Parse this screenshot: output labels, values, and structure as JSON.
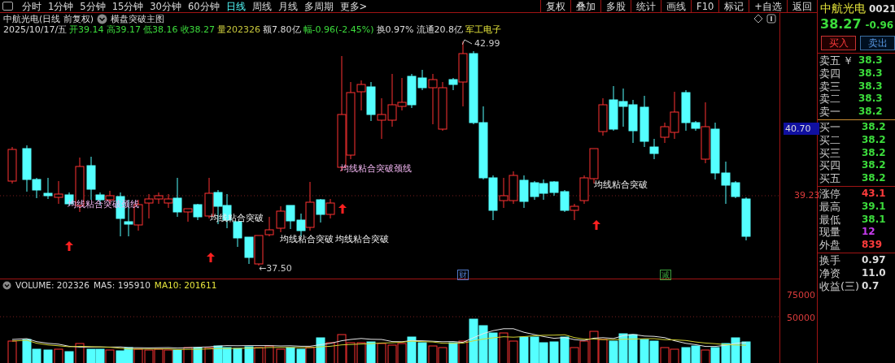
{
  "toolbar": {
    "periods": [
      {
        "label": "分时",
        "selected": false
      },
      {
        "label": "1分钟",
        "selected": false
      },
      {
        "label": "5分钟",
        "selected": false
      },
      {
        "label": "15分钟",
        "selected": false
      },
      {
        "label": "30分钟",
        "selected": false
      },
      {
        "label": "60分钟",
        "selected": false
      },
      {
        "label": "日线",
        "selected": true
      },
      {
        "label": "周线",
        "selected": false
      },
      {
        "label": "月线",
        "selected": false
      },
      {
        "label": "多周期",
        "selected": false
      },
      {
        "label": "更多>",
        "selected": false
      }
    ],
    "buttons": [
      "复权",
      "叠加",
      "多股",
      "统计",
      "画线",
      "F10",
      "标记",
      "+自选",
      "返回"
    ]
  },
  "title": {
    "stock": "中航光电(日线 前复权)",
    "indicator": "横盘突破主图"
  },
  "quote_line": [
    {
      "text": "2025/10/17/五",
      "kind": "plain"
    },
    {
      "text": "开39.14",
      "kind": "down"
    },
    {
      "text": "高39.17",
      "kind": "down"
    },
    {
      "text": "低38.16",
      "kind": "down"
    },
    {
      "text": "收38.27",
      "kind": "down"
    },
    {
      "text": "量202326",
      "kind": "volume"
    },
    {
      "text": "额7.80亿",
      "kind": "plain"
    },
    {
      "text": "幅-0.96(-2.45%)",
      "kind": "down"
    },
    {
      "text": "换0.97%",
      "kind": "plain"
    },
    {
      "text": "流通20.8亿",
      "kind": "plain"
    },
    {
      "text": "军工电子",
      "kind": "sector"
    }
  ],
  "chart": {
    "annotations": [
      {
        "text": "均线粘合突破颈线",
        "kind": "neckline"
      },
      {
        "text": "均线粘合突破",
        "kind": "breakout"
      },
      {
        "text": "均线粘合突破",
        "kind": "breakout"
      },
      {
        "text": "均线粘合突破",
        "kind": "breakout"
      },
      {
        "text": "均线粘合突破颈线",
        "kind": "neckline"
      },
      {
        "text": "均线粘合突破",
        "kind": "breakout"
      }
    ],
    "high_mark": "42.99",
    "low_mark": "←37.50",
    "events": [
      {
        "text": "财",
        "color": "#5078c8"
      },
      {
        "text": "减",
        "color": "#3ca03c"
      }
    ]
  },
  "axis": {
    "cursor": "40.70",
    "level": "39.23",
    "volume_ticks": [
      "75000",
      "50000"
    ]
  },
  "volume": {
    "legend": [
      {
        "text": "VOLUME: 202326",
        "color": "#dcdcdc"
      },
      {
        "text": "MA5: 195910",
        "color": "#dcdcdc"
      },
      {
        "text": "MA10: 201611",
        "color": "#e6e63c"
      }
    ]
  },
  "quote": {
    "name": "中航光电",
    "code": "0021",
    "price": "38.27",
    "change": "-0.96",
    "buy": "买入",
    "sell": "卖出",
    "symbol": "￥",
    "book": [
      {
        "label": "卖五",
        "value": "38.3"
      },
      {
        "label": "卖四",
        "value": "38.3"
      },
      {
        "label": "卖三",
        "value": "38.3"
      },
      {
        "label": "卖二",
        "value": "38.3"
      },
      {
        "label": "卖一",
        "value": "38.2"
      }
    ],
    "bids": [
      {
        "label": "买一",
        "value": "38.2"
      },
      {
        "label": "买二",
        "value": "38.2"
      },
      {
        "label": "买三",
        "value": "38.2"
      },
      {
        "label": "买四",
        "value": "38.2"
      },
      {
        "label": "买五",
        "value": "38.2"
      }
    ],
    "stats": [
      {
        "label": "涨停",
        "value": "43.1",
        "color": "#ff3c3c"
      },
      {
        "label": "最高",
        "value": "39.1",
        "color": "#3cdc3c"
      },
      {
        "label": "最低",
        "value": "38.1",
        "color": "#3cdc3c"
      },
      {
        "label": "现量",
        "value": "12",
        "color": "#c83cf0"
      },
      {
        "label": "外盘",
        "value": "839",
        "color": "#ff3c3c"
      }
    ],
    "fundamentals": [
      {
        "label": "换手",
        "value": "0.97"
      },
      {
        "label": "净资",
        "value": "11.0"
      },
      {
        "label": "收益(三)",
        "value": "0.7"
      }
    ]
  }
}
